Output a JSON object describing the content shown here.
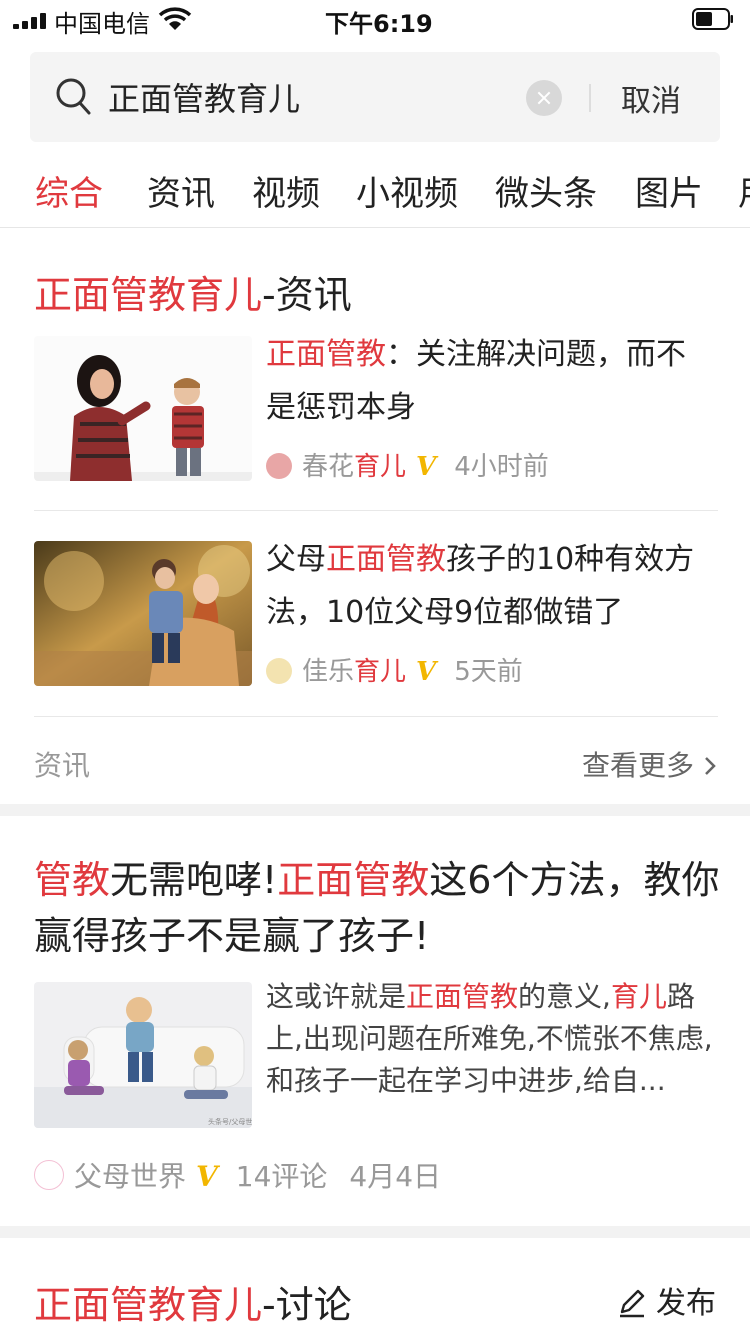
{
  "status": {
    "carrier": "中国电信",
    "time": "下午6:19"
  },
  "search": {
    "query": "正面管教育儿",
    "cancel": "取消"
  },
  "tabs": [
    "综合",
    "资讯",
    "视频",
    "小视频",
    "微头条",
    "图片",
    "用"
  ],
  "news_section": {
    "title_highlight": "正面管教育儿",
    "title_rest": "-资讯",
    "items": [
      {
        "title_highlight": "正面管教",
        "title_rest": "：关注解决问题，而不是惩罚本身",
        "source_plain": "春花",
        "source_highlight": "育儿",
        "time": "4小时前"
      },
      {
        "title_pre": "父母",
        "title_highlight": "正面管教",
        "title_rest": "孩子的10种有效方法，10位父母9位都做错了",
        "source_plain": "佳乐",
        "source_highlight": "育儿",
        "time": "5天前"
      }
    ],
    "footer_label": "资讯",
    "more": "查看更多"
  },
  "article": {
    "t1": "管教",
    "t2": "无需咆哮!",
    "t3": "正面管教",
    "t4": "这6个方法，教你赢得孩子不是赢了孩子!",
    "s1": "这或许就是",
    "s2": "正面管教",
    "s3": "的意义,",
    "s4": "育儿",
    "s5": "路上,出现问题在所难免,不慌张不焦虑,和孩子一起在学习中进步,给自...",
    "watermark": "头条号/父母世界",
    "source": "父母世界",
    "comments": "14评论",
    "date": "4月4日"
  },
  "discussion": {
    "title_highlight": "正面管教育儿",
    "title_rest": "-讨论",
    "publish": "发布"
  },
  "colors": {
    "accent": "#e0393e",
    "verified": "#f2b600",
    "muted": "#999999"
  }
}
